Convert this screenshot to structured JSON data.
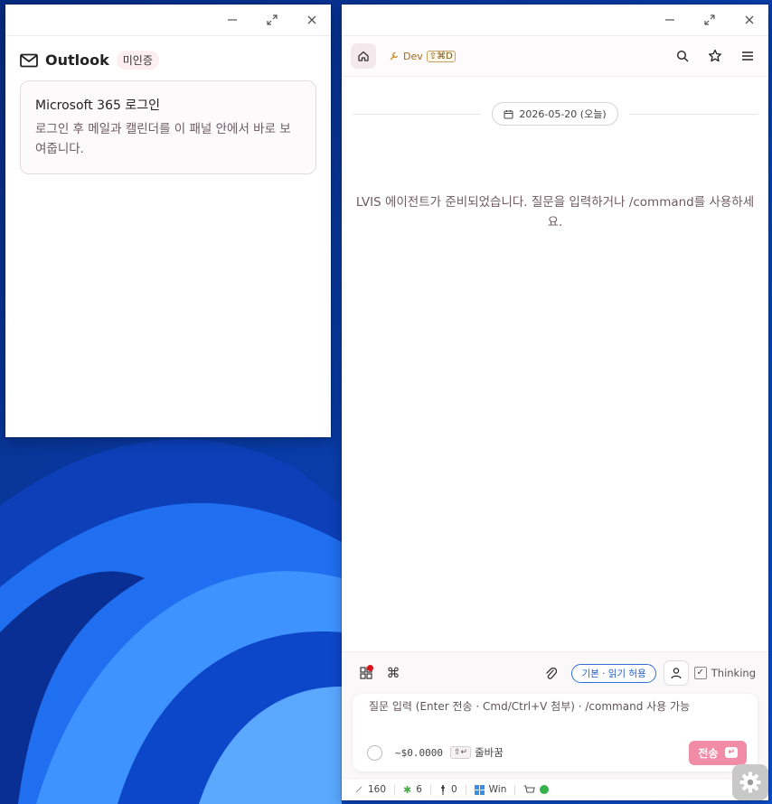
{
  "outlook": {
    "title": "Outlook",
    "status_badge": "미인증",
    "card_title": "Microsoft 365 로그인",
    "card_desc": "로그인 후 메일과 캘린더를 이 패널 안에서 바로 보여줍니다."
  },
  "lvis": {
    "dev_label": "Dev",
    "dev_shortcut": "⇧⌘D",
    "date_pill": "2026-05-20 (오늘)",
    "welcome": "LVIS 에이전트가 준비되었습니다. 질문을 입력하거나 /command를 사용하세요.",
    "permission_pill": "기본 · 읽기 허용",
    "thinking_label": "Thinking",
    "input_placeholder": "질문 입력 (Enter 전송 · Cmd/Ctrl+V 첨부) · /command 사용 가능",
    "cost": "~$0.0000",
    "wrap_shortcut": "⇧↵",
    "wrap_label": "줄바꿈",
    "send_label": "전송",
    "send_shortcut": "↵",
    "status": {
      "tokens": "160",
      "plugins": "6",
      "pins": "0",
      "platform": "Win"
    },
    "accent": "#f28ca6",
    "online_color": "#33b24a"
  }
}
